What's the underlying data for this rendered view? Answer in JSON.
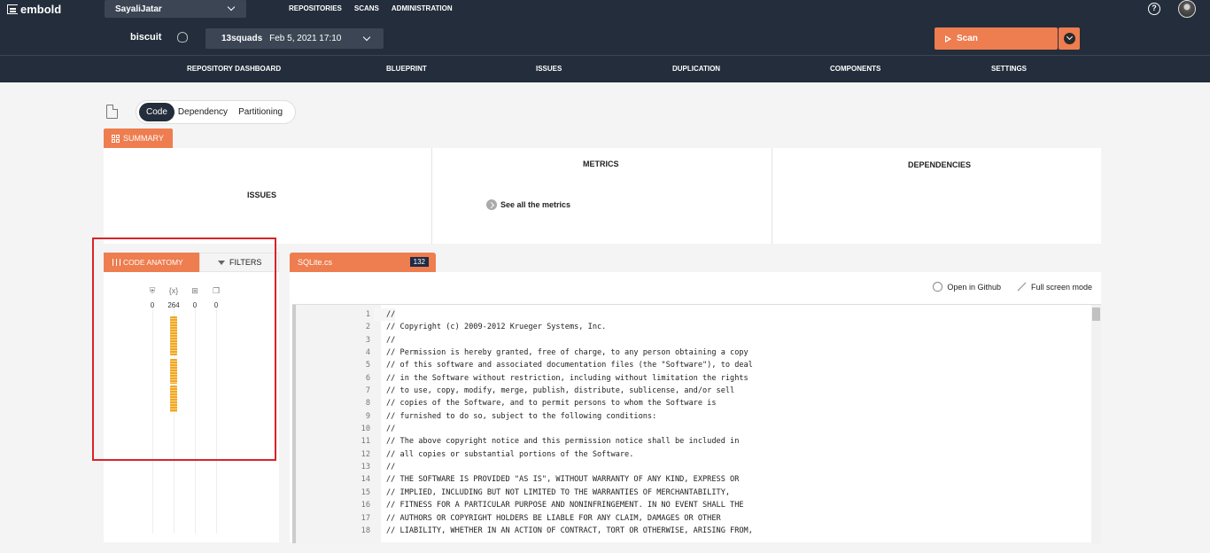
{
  "app": {
    "logo": "embold"
  },
  "topbar": {
    "user": "SayaliJatar",
    "nav": [
      "REPOSITORIES",
      "SCANS",
      "ADMINISTRATION"
    ]
  },
  "repobar": {
    "repo": "biscuit",
    "snapshot_branch": "13squads",
    "snapshot_date": "Feb 5, 2021 17:10",
    "scan_label": "Scan"
  },
  "mainnav": {
    "items": [
      "REPOSITORY DASHBOARD",
      "BLUEPRINT",
      "ISSUES",
      "DUPLICATION",
      "COMPONENTS",
      "SETTINGS"
    ]
  },
  "view_toggle": {
    "options": [
      "Code",
      "Dependency",
      "Partitioning"
    ],
    "selected": "Code"
  },
  "summary": {
    "tab": "SUMMARY",
    "issues_title": "ISSUES",
    "metrics_title": "METRICS",
    "metrics_link": "See all the metrics",
    "dependencies_title": "DEPENDENCIES"
  },
  "anatomy": {
    "tab_active": "CODE ANATOMY",
    "tab_filters": "FILTERS",
    "metrics": [
      {
        "icon": "shield-icon",
        "value": "0"
      },
      {
        "icon": "variable-icon",
        "value": "264"
      },
      {
        "icon": "components-icon",
        "value": "0"
      },
      {
        "icon": "duplicate-icon",
        "value": "0"
      }
    ]
  },
  "code": {
    "file_name": "SQLite.cs",
    "line_count_badge": "132",
    "open_github": "Open in Github",
    "full_screen": "Full screen mode",
    "lines": [
      {
        "n": "1",
        "t": "//"
      },
      {
        "n": "2",
        "t": "// Copyright (c) 2009-2012 Krueger Systems, Inc."
      },
      {
        "n": "3",
        "t": "//"
      },
      {
        "n": "4",
        "t": "// Permission is hereby granted, free of charge, to any person obtaining a copy"
      },
      {
        "n": "5",
        "t": "// of this software and associated documentation files (the \"Software\"), to deal"
      },
      {
        "n": "6",
        "t": "// in the Software without restriction, including without limitation the rights"
      },
      {
        "n": "7",
        "t": "// to use, copy, modify, merge, publish, distribute, sublicense, and/or sell"
      },
      {
        "n": "8",
        "t": "// copies of the Software, and to permit persons to whom the Software is"
      },
      {
        "n": "9",
        "t": "// furnished to do so, subject to the following conditions:"
      },
      {
        "n": "10",
        "t": "//"
      },
      {
        "n": "11",
        "t": "// The above copyright notice and this permission notice shall be included in"
      },
      {
        "n": "12",
        "t": "// all copies or substantial portions of the Software."
      },
      {
        "n": "13",
        "t": "//"
      },
      {
        "n": "14",
        "t": "// THE SOFTWARE IS PROVIDED \"AS IS\", WITHOUT WARRANTY OF ANY KIND, EXPRESS OR"
      },
      {
        "n": "15",
        "t": "// IMPLIED, INCLUDING BUT NOT LIMITED TO THE WARRANTIES OF MERCHANTABILITY,"
      },
      {
        "n": "16",
        "t": "// FITNESS FOR A PARTICULAR PURPOSE AND NONINFRINGEMENT. IN NO EVENT SHALL THE"
      },
      {
        "n": "17",
        "t": "// AUTHORS OR COPYRIGHT HOLDERS BE LIABLE FOR ANY CLAIM, DAMAGES OR OTHER"
      },
      {
        "n": "18",
        "t": "// LIABILITY, WHETHER IN AN ACTION OF CONTRACT, TORT OR OTHERWISE, ARISING FROM,"
      }
    ]
  },
  "colors": {
    "navbar": "#232d3b",
    "accent": "#ee7d4f",
    "highlight_box": "#d8232a"
  }
}
